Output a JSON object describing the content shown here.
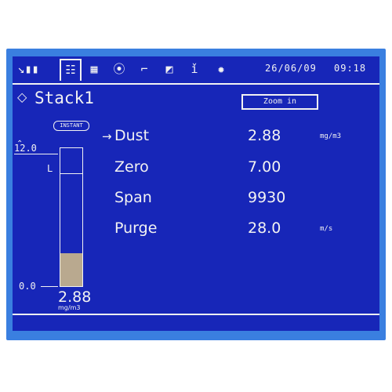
{
  "toolbar": {
    "icons": [
      {
        "name": "measurement-icon",
        "glyph": "↘▮▮"
      },
      {
        "name": "list-menu-icon",
        "glyph": "☷"
      },
      {
        "name": "grid-icon",
        "glyph": "▦"
      },
      {
        "name": "alarm-icon",
        "glyph": "⦿"
      },
      {
        "name": "trend-chart-icon",
        "glyph": "⌐"
      },
      {
        "name": "calibration-icon",
        "glyph": "◩"
      },
      {
        "name": "probe-icon",
        "glyph": "ǐ"
      },
      {
        "name": "sensor-icon",
        "glyph": "✹"
      }
    ],
    "date": "26/06/09",
    "time": "09:18"
  },
  "header": {
    "selector_glyph": "◇",
    "title": "Stack1",
    "zoom_label": "Zoom in"
  },
  "gauge": {
    "mode_badge": "INSTANT",
    "max_label": "12.0",
    "min_label": "0.0",
    "level_marker": "L",
    "level_fraction": 0.82,
    "fill_fraction": 0.24,
    "value": "2.88",
    "unit": "mg/m3"
  },
  "readings": [
    {
      "label": "Dust",
      "value": "2.88",
      "unit": "mg/m3",
      "selected": true
    },
    {
      "label": "Zero",
      "value": "7.00",
      "unit": "",
      "selected": false
    },
    {
      "label": "Span",
      "value": "9930",
      "unit": "",
      "selected": false
    },
    {
      "label": "Purge",
      "value": "28.0",
      "unit": "m/s",
      "selected": false
    }
  ],
  "colors": {
    "screen_bg": "#1726b8",
    "bezel": "#3a7fe0",
    "foreground": "#f2f2f2",
    "bar_fill": "#b9a98f"
  }
}
